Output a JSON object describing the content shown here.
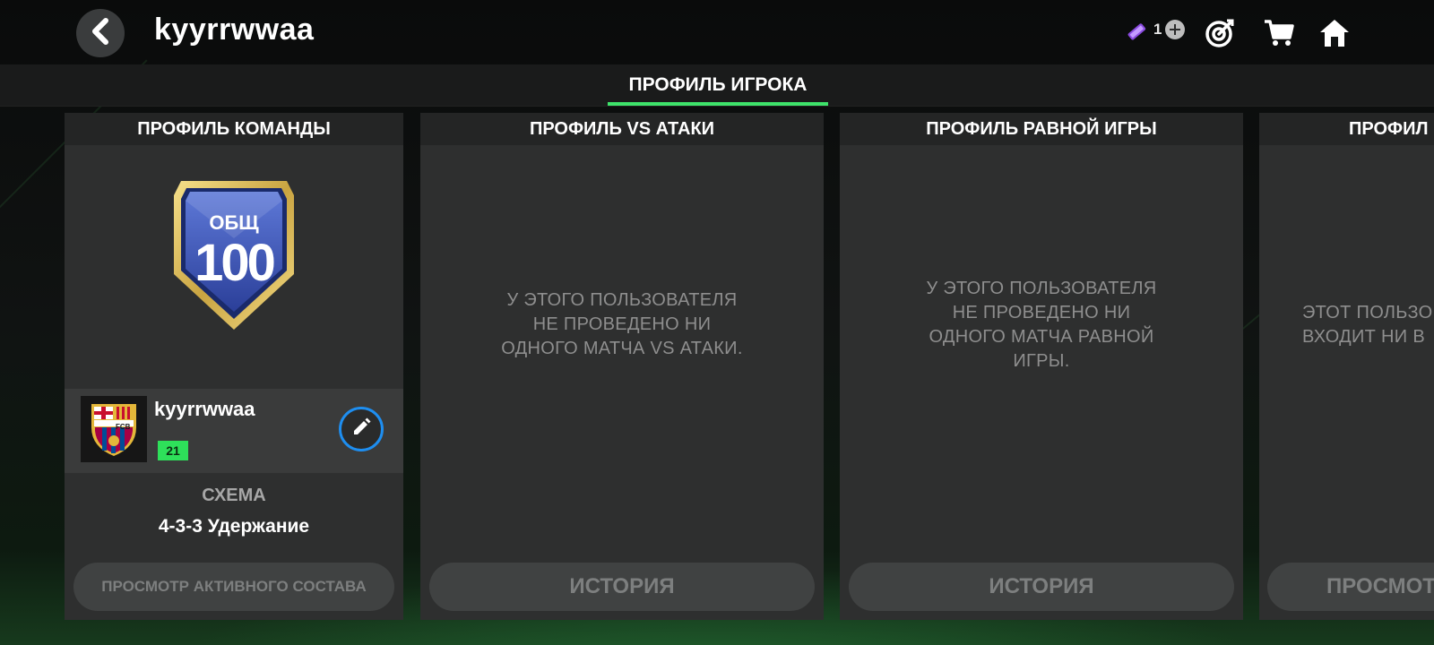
{
  "header": {
    "title": "kyyrrwwaa",
    "currency_count": "1",
    "icons": [
      "back-arrow-icon",
      "gem-icon",
      "plus-icon",
      "target-icon",
      "cart-icon",
      "home-icon"
    ]
  },
  "tabs": {
    "active": "ПРОФИЛЬ ИГРОКА"
  },
  "panels": {
    "team": {
      "header": "ПРОФИЛЬ КОМАНДЫ",
      "ovr_label": "ОБЩ",
      "ovr_value": "100",
      "team_name": "kyyrrwwaa",
      "level": "21",
      "club_logo_text": "FCB",
      "scheme_label": "СХЕМА",
      "scheme_value": "4-3-3 Удержание",
      "button": "ПРОСМОТР АКТИВНОГО СОСТАВА"
    },
    "vs_attack": {
      "header": "ПРОФИЛЬ VS АТАКИ",
      "message_lines": [
        "У ЭТОГО ПОЛЬЗОВАТЕЛЯ",
        "НЕ ПРОВЕДЕНО НИ",
        "ОДНОГО МАТЧА VS АТАКИ."
      ],
      "button": "ИСТОРИЯ"
    },
    "h2h": {
      "header": "ПРОФИЛЬ РАВНОЙ ИГРЫ",
      "message_lines": [
        "У ЭТОГО ПОЛЬЗОВАТЕЛЯ",
        "НЕ ПРОВЕДЕНО НИ",
        "ОДНОГО МАТЧА РАВНОЙ",
        "ИГРЫ."
      ],
      "button": "ИСТОРИЯ"
    },
    "partial": {
      "header": "ПРОФИЛ",
      "message_lines": [
        "ЭТОТ ПОЛЬЗО",
        "ВХОДИТ НИ В"
      ],
      "button": "ПРОСМОТ"
    }
  },
  "colors": {
    "accent_green": "#3ee36a",
    "edit_ring_blue": "#1e8ef0",
    "panel_bg": "#2e2f2f"
  }
}
